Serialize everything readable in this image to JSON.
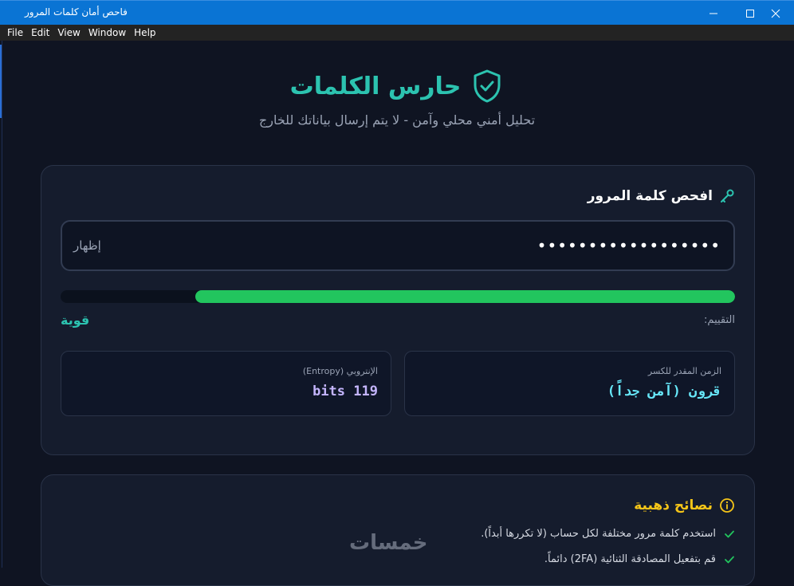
{
  "window": {
    "title": "فاحص أمان كلمات المرور",
    "menu": [
      "File",
      "Edit",
      "View",
      "Window",
      "Help"
    ]
  },
  "header": {
    "title": "حارس الكلمات",
    "subtitle": "تحليل أمني محلي وآمن - لا يتم إرسال بياناتك للخارج",
    "icon": "shield-check-icon",
    "accent": "#2cc3b0"
  },
  "checker": {
    "title": "افحص كلمة المرور",
    "icon": "key-icon",
    "password_masked": "••••••••••••••••••",
    "toggle_label": "إظهار",
    "strength_fraction": 0.8,
    "strength_color": "#22c55e",
    "rating_label": "التقييم:",
    "rating_value": "قوية",
    "stats": {
      "crack_time_label": "الزمن المقدر للكسر",
      "crack_time_value": "قرون (آمن جداً)",
      "entropy_label": "الإنتروبي (Entropy)",
      "entropy_value": "119 bits"
    }
  },
  "tips": {
    "title": "نصائح ذهبية",
    "icon": "info-icon",
    "items": [
      "استخدم كلمة مرور مختلفة لكل حساب (لا تكررها أبداً).",
      "قم بتفعيل المصادقة الثنائية (2FA) دائماً."
    ]
  },
  "watermark": "خمسات"
}
